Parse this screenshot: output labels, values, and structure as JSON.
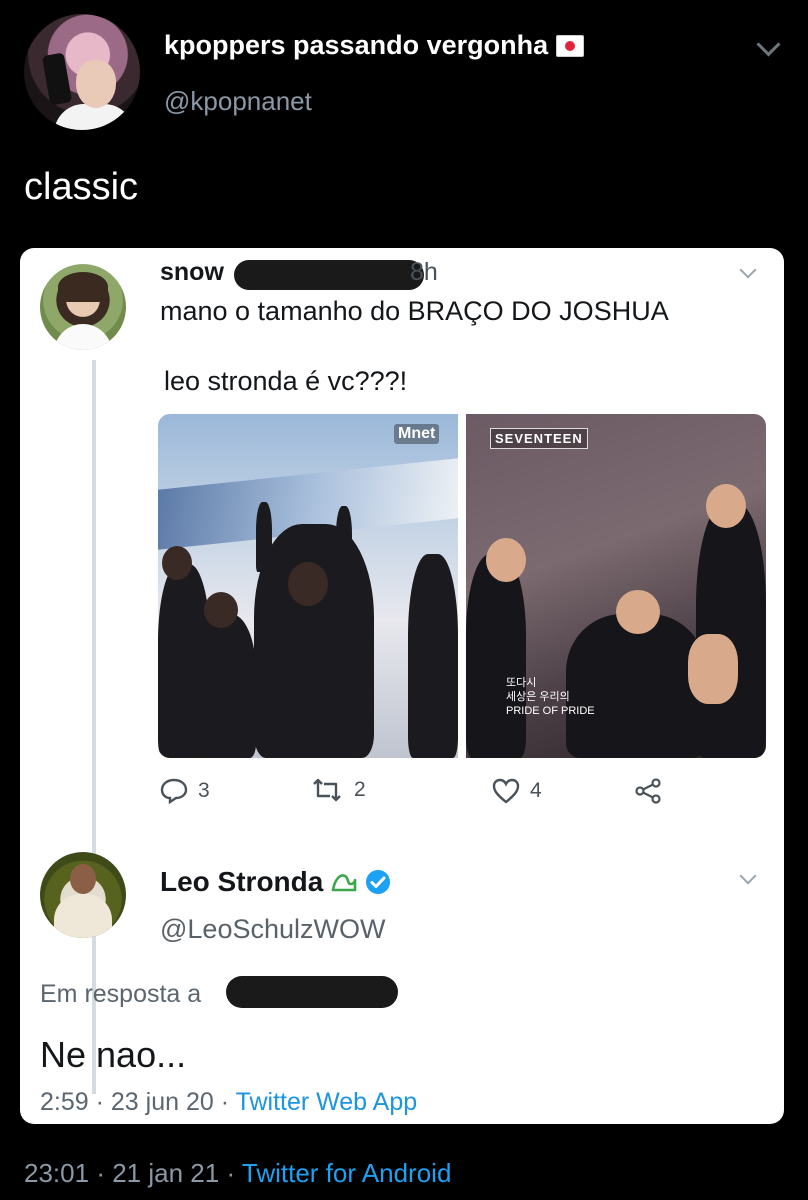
{
  "tweet": {
    "name": "kpoppers passando vergonha",
    "handle": "@kpopnanet",
    "text": "classic",
    "time": "23:01",
    "sep1": "·",
    "date": "21 jan 21",
    "sep2": "·",
    "source": "Twitter for Android"
  },
  "quoted_original": {
    "name": "snow",
    "time": "8h",
    "line1": "mano o tamanho do BRAÇO DO JOSHUA",
    "line2": "leo stronda é vc???!",
    "media_left_logo": "Mnet",
    "media_right_logo": "SEVENTEEN",
    "media_right_caption1": "또다시",
    "media_right_caption2": "세상은 우리의",
    "media_right_caption3": "PRIDE OF PRIDE",
    "replies": "3",
    "retweets": "2",
    "likes": "4"
  },
  "quoted_reply": {
    "name": "Leo Stronda",
    "handle": "@LeoSchulzWOW",
    "reply_prefix": "Em resposta a",
    "text": "Ne nao...",
    "time": "2:59",
    "sep1": "·",
    "date": "23 jun 20",
    "sep2": "·",
    "source": "Twitter Web App"
  },
  "colors": {
    "background": "#000000",
    "link": "#1da1f2",
    "verified": "#1da1f2"
  }
}
